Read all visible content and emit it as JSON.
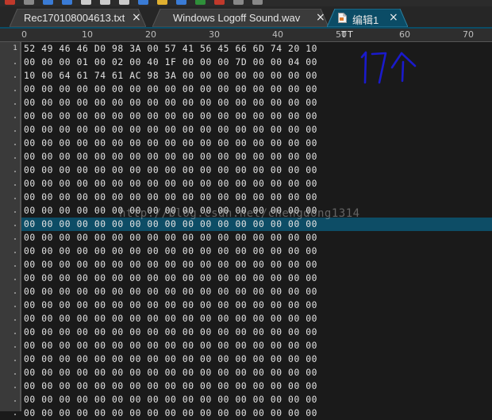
{
  "toolbar": {
    "icons": [
      {
        "name": "toolbar-icon-1",
        "color": "#c0392b"
      },
      {
        "name": "toolbar-icon-2",
        "color": "#888888"
      },
      {
        "name": "toolbar-icon-3",
        "color": "#3a7bd5"
      },
      {
        "name": "toolbar-icon-4",
        "color": "#3a7bd5"
      },
      {
        "name": "toolbar-icon-5",
        "color": "#cccccc"
      },
      {
        "name": "toolbar-icon-6",
        "color": "#cccccc"
      },
      {
        "name": "toolbar-icon-7",
        "color": "#cccccc"
      },
      {
        "name": "toolbar-icon-8",
        "color": "#3a7bd5"
      },
      {
        "name": "toolbar-icon-9",
        "color": "#e0b030"
      },
      {
        "name": "toolbar-icon-10",
        "color": "#3a7bd5"
      },
      {
        "name": "toolbar-icon-11",
        "color": "#2f8f3a"
      },
      {
        "name": "toolbar-icon-12",
        "color": "#c0392b"
      },
      {
        "name": "toolbar-icon-13",
        "color": "#888888"
      },
      {
        "name": "toolbar-icon-14",
        "color": "#888888"
      }
    ]
  },
  "tabs": [
    {
      "label": "Rec170108004613.txt",
      "close": "×",
      "active": false
    },
    {
      "label": "Windows Logoff Sound.wav",
      "close": "×",
      "active": false
    },
    {
      "label": "编辑1",
      "close": "×",
      "active": true
    }
  ],
  "ruler": {
    "labels": [
      "0",
      "10",
      "20",
      "30",
      "40",
      "50",
      "60",
      "70"
    ],
    "markers": [
      "T",
      "T"
    ]
  },
  "gutter": {
    "first_line_number": "1"
  },
  "hex_rows": [
    "52 49 46 46 D0 98 3A 00 57 41 56 45 66 6D 74 20 10",
    "00 00 00 01 00 02 00 40 1F 00 00 00 7D 00 00 04 00",
    "10 00 64 61 74 61 AC 98 3A 00 00 00 00 00 00 00 00",
    "00 00 00 00 00 00 00 00 00 00 00 00 00 00 00 00 00",
    "00 00 00 00 00 00 00 00 00 00 00 00 00 00 00 00 00",
    "00 00 00 00 00 00 00 00 00 00 00 00 00 00 00 00 00",
    "00 00 00 00 00 00 00 00 00 00 00 00 00 00 00 00 00",
    "00 00 00 00 00 00 00 00 00 00 00 00 00 00 00 00 00",
    "00 00 00 00 00 00 00 00 00 00 00 00 00 00 00 00 00",
    "00 00 00 00 00 00 00 00 00 00 00 00 00 00 00 00 00",
    "00 00 00 00 00 00 00 00 00 00 00 00 00 00 00 00 00",
    "00 00 00 00 00 00 00 00 00 00 00 00 00 00 00 00 00",
    "00 00 00 00 00 00 00 00 00 00 00 00 00 00 00 00 00",
    "00 00 00 00 00 00 00 00 00 00 00 00 00 00 00 00 00",
    "00 00 00 00 00 00 00 00 00 00 00 00 00 00 00 00 00",
    "00 00 00 00 00 00 00 00 00 00 00 00 00 00 00 00 00",
    "00 00 00 00 00 00 00 00 00 00 00 00 00 00 00 00 00",
    "00 00 00 00 00 00 00 00 00 00 00 00 00 00 00 00 00",
    "00 00 00 00 00 00 00 00 00 00 00 00 00 00 00 00 00",
    "00 00 00 00 00 00 00 00 00 00 00 00 00 00 00 00 00",
    "00 00 00 00 00 00 00 00 00 00 00 00 00 00 00 00 00",
    "00 00 00 00 00 00 00 00 00 00 00 00 00 00 00 00 00",
    "00 00 00 00 00 00 00 00 00 00 00 00 00 00 00 00 00",
    "00 00 00 00 00 00 00 00 00 00 00 00 00 00 00 00 00",
    "00 00 00 00 00 00 00 00 00 00 00 00 00 00 00 00 00",
    "00 00 00 00 00 00 00 00 00 00 00 00 00 00 00 00 00",
    "00 00 00 00 00 00 00 00 00 00 00 00 00 00 00 00 00",
    "00 00 00 00 00 00 00 00 00 00 00 00 00 00 00 00 00"
  ],
  "current_row_index": 13,
  "watermark": "http://blog.csdn.net/chengdong1314",
  "annotation": {
    "text": "17个",
    "color": "#1a1acc"
  },
  "colors": {
    "current_line": "#0d4d66",
    "text": "#e4e4e4",
    "background": "#1a1a1a"
  }
}
